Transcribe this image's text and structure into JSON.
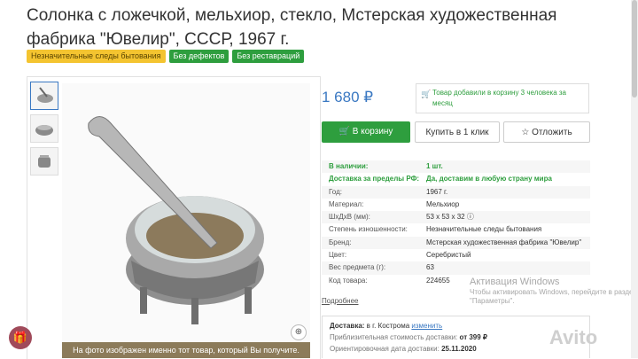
{
  "title": "Солонка с ложечкой, мельхиор, стекло, Мстерская художественная фабрика \"Ювелир\", СССР, 1967 г.",
  "badges": [
    "Незначительные следы бытования",
    "Без дефектов",
    "Без реставраций"
  ],
  "caption": "На фото изображен именно тот товар, который Вы получите.",
  "price": "1 680 ₽",
  "notice": "Товар добавили в корзину 3 человека за месяц",
  "buttons": {
    "cart": "В корзину",
    "one_click": "Купить в 1 клик",
    "later": "Отложить"
  },
  "specs": [
    {
      "k": "В наличии:",
      "v": "1 шт."
    },
    {
      "k": "Доставка за пределы РФ:",
      "v": "Да, доставим в любую страну мира"
    },
    {
      "k": "Год:",
      "v": "1967 г."
    },
    {
      "k": "Материал:",
      "v": "Мельхиор"
    },
    {
      "k": "ШхДхВ (мм):",
      "v": "53 x 53 x 32"
    },
    {
      "k": "Степень изношенности:",
      "v": "Незначительные следы бытования"
    },
    {
      "k": "Бренд:",
      "v": "Мстерская художественная фабрика \"Ювелир\""
    },
    {
      "k": "Цвет:",
      "v": "Серебристый"
    },
    {
      "k": "Вес предмета (г):",
      "v": "63"
    },
    {
      "k": "Код товара:",
      "v": "224655"
    }
  ],
  "more": "Подробнее",
  "delivery": {
    "label": "Доставка:",
    "city": "в г. Кострома",
    "change": "изменить",
    "cost_label": "Приблизительная стоимость доставки:",
    "cost": "от 399 ₽",
    "date_label": "Ориентировочная дата доставки:",
    "date": "25.11.2020"
  },
  "watermark": {
    "title": "Активация Windows",
    "text": "Чтобы активировать Windows, перейдите в раздел \"Параметры\"."
  },
  "brand": "Avito"
}
